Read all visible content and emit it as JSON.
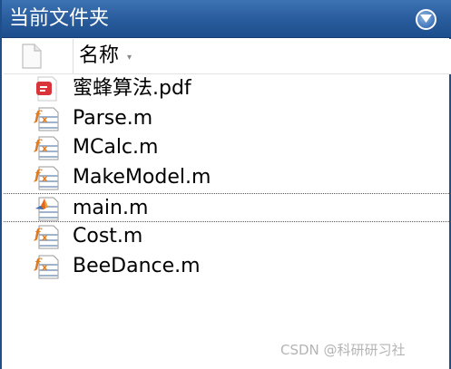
{
  "panel": {
    "title": "当前文件夹"
  },
  "header": {
    "name_column": "名称",
    "sort_indicator": "▾"
  },
  "files": [
    {
      "name": "蜜蜂算法.pdf",
      "icon": "pdf-file-icon"
    },
    {
      "name": "Parse.m",
      "icon": "function-file-icon"
    },
    {
      "name": "MCalc.m",
      "icon": "function-file-icon"
    },
    {
      "name": "MakeModel.m",
      "icon": "function-file-icon"
    },
    {
      "name": "main.m",
      "icon": "script-file-icon",
      "selected": true
    },
    {
      "name": "Cost.m",
      "icon": "function-file-icon"
    },
    {
      "name": "BeeDance.m",
      "icon": "function-file-icon"
    }
  ],
  "watermark": "CSDN @科研研习社",
  "colors": {
    "titlebar": "#2b5f9f",
    "border": "#1e4f8a",
    "pdf_red": "#d9343a",
    "function_orange": "#e07a1f",
    "text": "#000000"
  }
}
